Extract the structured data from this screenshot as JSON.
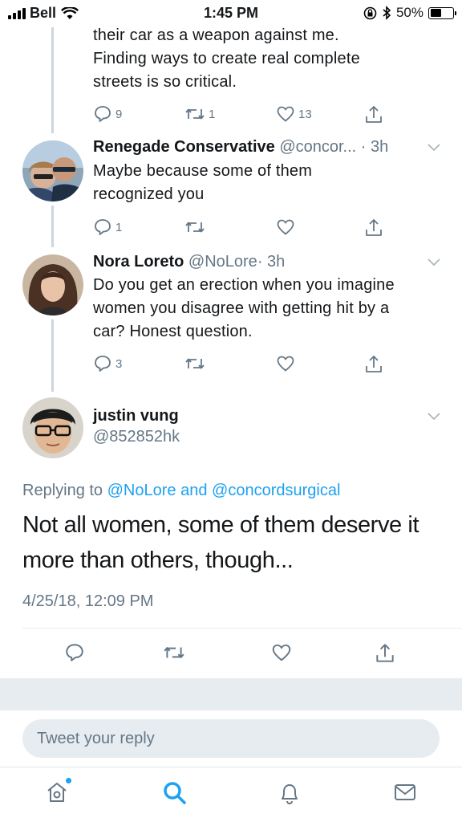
{
  "status_bar": {
    "carrier": "Bell",
    "time": "1:45 PM",
    "battery_text": "50%",
    "battery_level": 0.5
  },
  "tweets": [
    {
      "text_lines": [
        "their car as a weapon against me.",
        "Finding ways to create real complete",
        "streets is so critical."
      ],
      "reply_count": "9",
      "retweet_count": "1",
      "like_count": "13"
    },
    {
      "name": "Renegade Conservative",
      "handle": "@concor...",
      "time": "· 3h",
      "text_lines": [
        "Maybe because some of them",
        "recognized you"
      ],
      "reply_count": "1",
      "retweet_count": "",
      "like_count": ""
    },
    {
      "name": "Nora Loreto",
      "handle": "@NoLore",
      "time": "· 3h",
      "text_lines": [
        "Do you get an erection when you imagine",
        "women you disagree with getting hit by a",
        "car? Honest question."
      ],
      "reply_count": "3",
      "retweet_count": "",
      "like_count": ""
    }
  ],
  "main_tweet": {
    "name": "justin vung",
    "handle": "@852852hk",
    "replying_prefix": "Replying to",
    "mention_1": "@NoLore",
    "and_word": "and",
    "mention_2": "@concordsurgical",
    "text_lines": [
      "Not all women, some of them deserve it",
      "more than others, though..."
    ],
    "timestamp": "4/25/18, 12:09 PM"
  },
  "reply_bar": {
    "placeholder": "Tweet your reply"
  },
  "tab_bar": {
    "tabs": [
      "home-icon",
      "search-icon",
      "notifications-icon",
      "messages-icon"
    ]
  },
  "colors": {
    "accent": "#1da1f2",
    "secondary_text": "#657786",
    "thread_line": "#ccd6dd"
  }
}
